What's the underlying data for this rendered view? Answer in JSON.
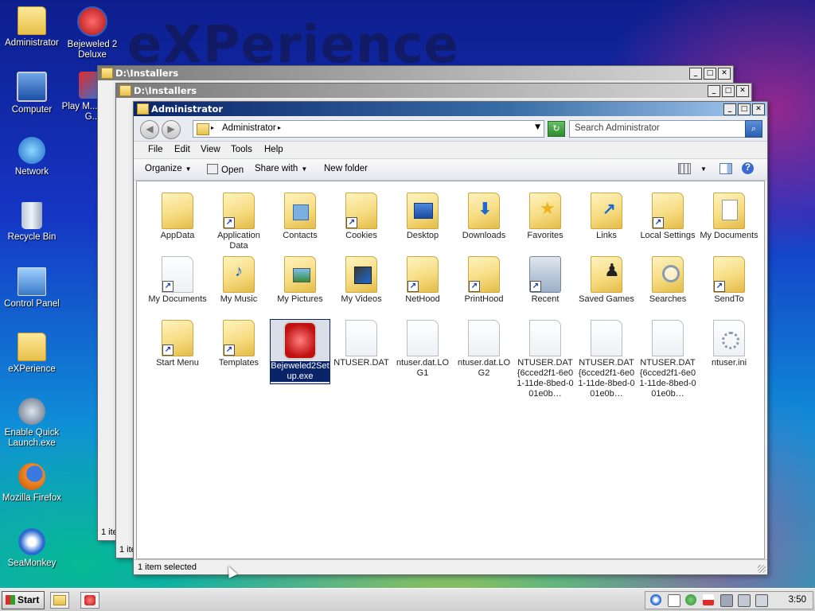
{
  "desktop": {
    "watermark": "eXPerience",
    "icons": [
      {
        "label": "Administrator",
        "icon": "folder-icon"
      },
      {
        "label": "Bejeweled 2 Deluxe",
        "icon": "bejeweled-icon"
      },
      {
        "label": "Computer",
        "icon": "computer-icon"
      },
      {
        "label": "Play M... Great G...",
        "icon": "games-icon"
      },
      {
        "label": "Network",
        "icon": "network-icon"
      },
      {
        "label": "Recycle Bin",
        "icon": "recycle-bin-icon"
      },
      {
        "label": "Control Panel",
        "icon": "control-panel-icon"
      },
      {
        "label": "eXPerience",
        "icon": "folder-icon"
      },
      {
        "label": "Enable Quick Launch.exe",
        "icon": "exe-icon"
      },
      {
        "label": "Mozilla Firefox",
        "icon": "firefox-icon"
      },
      {
        "label": "SeaMonkey",
        "icon": "seamonkey-icon"
      }
    ]
  },
  "bg_windows": [
    {
      "title": "D:\\Installers",
      "status": "1 ite"
    },
    {
      "title": "D:\\Installers",
      "status": "1 ite"
    }
  ],
  "window": {
    "title": "Administrator",
    "address": "Administrator",
    "search_placeholder": "Search Administrator",
    "menu": [
      "File",
      "Edit",
      "View",
      "Tools",
      "Help"
    ],
    "commands": [
      "Organize",
      "Open",
      "Share with",
      "New folder"
    ],
    "status": "1 item selected",
    "items": [
      {
        "label": "AppData",
        "kind": "folder"
      },
      {
        "label": "Application Data",
        "kind": "folder-shortcut"
      },
      {
        "label": "Contacts",
        "kind": "folder"
      },
      {
        "label": "Cookies",
        "kind": "folder-shortcut"
      },
      {
        "label": "Desktop",
        "kind": "folder"
      },
      {
        "label": "Downloads",
        "kind": "folder"
      },
      {
        "label": "Favorites",
        "kind": "folder"
      },
      {
        "label": "Links",
        "kind": "folder"
      },
      {
        "label": "Local Settings",
        "kind": "folder-shortcut"
      },
      {
        "label": "My Documents",
        "kind": "folder"
      },
      {
        "label": "My Documents",
        "kind": "folder-shortcut"
      },
      {
        "label": "My Music",
        "kind": "folder"
      },
      {
        "label": "My Pictures",
        "kind": "folder"
      },
      {
        "label": "My Videos",
        "kind": "folder"
      },
      {
        "label": "NetHood",
        "kind": "folder-shortcut"
      },
      {
        "label": "PrintHood",
        "kind": "folder-shortcut"
      },
      {
        "label": "Recent",
        "kind": "folder-shortcut"
      },
      {
        "label": "Saved Games",
        "kind": "folder"
      },
      {
        "label": "Searches",
        "kind": "folder"
      },
      {
        "label": "SendTo",
        "kind": "folder-shortcut"
      },
      {
        "label": "Start Menu",
        "kind": "folder-shortcut"
      },
      {
        "label": "Templates",
        "kind": "folder-shortcut"
      },
      {
        "label": "Bejeweled2Setup.exe",
        "kind": "exe",
        "selected": true
      },
      {
        "label": "NTUSER.DAT",
        "kind": "file"
      },
      {
        "label": "ntuser.dat.LOG1",
        "kind": "file"
      },
      {
        "label": "ntuser.dat.LOG2",
        "kind": "file"
      },
      {
        "label": "NTUSER.DAT{6cced2f1-6e01-11de-8bed-001e0b…",
        "kind": "file"
      },
      {
        "label": "NTUSER.DAT{6cced2f1-6e01-11de-8bed-001e0b…",
        "kind": "file"
      },
      {
        "label": "NTUSER.DAT{6cced2f1-6e01-11de-8bed-001e0b…",
        "kind": "file"
      },
      {
        "label": "ntuser.ini",
        "kind": "file-settings"
      }
    ]
  },
  "taskbar": {
    "start_label": "Start",
    "clock": "3:50"
  },
  "colors": {
    "title_active": "#0a246a",
    "selection": "#0a246a"
  }
}
